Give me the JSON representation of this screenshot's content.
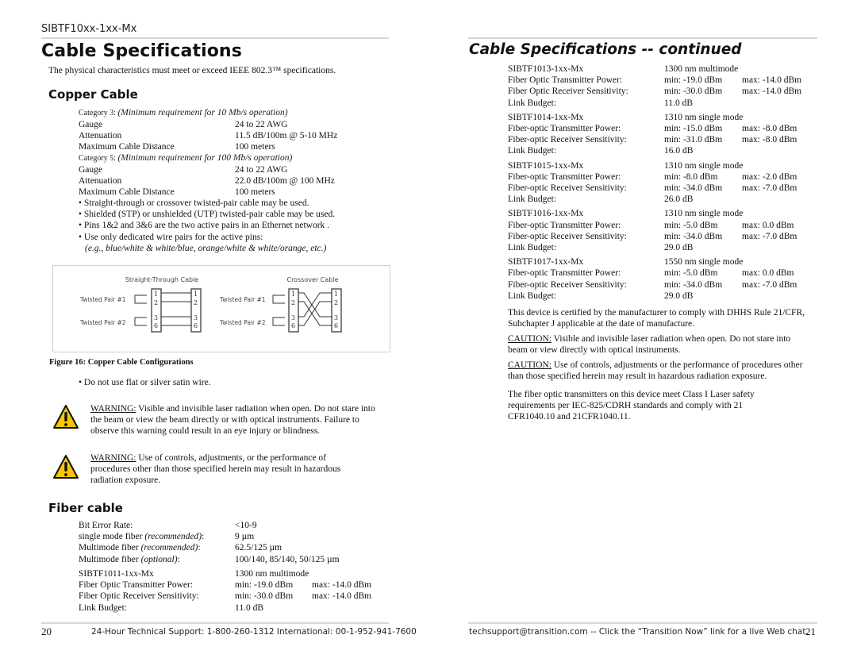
{
  "header": {
    "doc_id": "SIBTF10xx-1xx-Mx"
  },
  "left_page": {
    "title": "Cable Specifications",
    "intro": "The physical characteristics must meet or exceed IEEE 802.3™ specifications.",
    "copper": {
      "heading": "Copper Cable",
      "categories": [
        {
          "label": "Category 3:",
          "note": "(Minimum requirement for 10 Mb/s operation)",
          "rows": [
            {
              "k": "Gauge",
              "v": "24 to 22 AWG"
            },
            {
              "k": "Attenuation",
              "v": "11.5 dB/100m @ 5-10 MHz"
            },
            {
              "k": "Maximum Cable Distance",
              "v": "100 meters"
            }
          ]
        },
        {
          "label": "Category 5:",
          "note": "(Minimum requirement for 100 Mb/s operation)",
          "rows": [
            {
              "k": "Gauge",
              "v": "24 to 22 AWG"
            },
            {
              "k": "Attenuation",
              "v": "22.0 dB/100m @ 100 MHz"
            },
            {
              "k": "Maximum Cable Distance",
              "v": "100 meters"
            }
          ]
        }
      ],
      "bullets": [
        "Straight-through or crossover twisted-pair cable may be used.",
        "Shielded (STP) or unshielded (UTP) twisted-pair cable may be used.",
        "Pins 1&2 and 3&6 are the two active pairs in an Ethernet network .",
        "Use only dedicated wire pairs for the active pins:"
      ],
      "bullet_example": "(e.g., blue/white & white/blue, orange/white & white/orange, etc.)"
    },
    "figure": {
      "straight_title": "Straight-Through Cable",
      "crossover_title": "Crossover Cable",
      "pair1": "Twisted Pair #1",
      "pair2": "Twisted Pair #2",
      "pins": [
        "1",
        "2",
        "3",
        "6"
      ],
      "caption": "Figure 16:  Copper Cable Configurations"
    },
    "after_figure_bullet": "Do not use flat or silver satin wire.",
    "warnings": [
      {
        "label": "WARNING:",
        "text": " Visible and invisible laser radiation when open. Do not stare into the beam or view the beam directly or with optical instruments. Failure to observe this warning could result in an eye injury or blindness."
      },
      {
        "label": "WARNING:",
        "text": " Use of controls, adjustments, or the performance of procedures other than those specified herein may result in hazardous radiation exposure."
      }
    ],
    "fiber": {
      "heading": "Fiber cable",
      "general": [
        {
          "k": "Bit Error Rate:",
          "k_em": "",
          "v": "<10-9"
        },
        {
          "k": "single mode fiber ",
          "k_em": "(recommended)",
          "k_tail": ":",
          "v": "9 µm"
        },
        {
          "k": "Multimode fiber ",
          "k_em": "(recommended)",
          "k_tail": ":",
          "v": "62.5/125 µm"
        },
        {
          "k": "Multimode fiber ",
          "k_em": "(optional)",
          "k_tail": ":",
          "v": "100/140, 85/140, 50/125 µm"
        }
      ],
      "model": {
        "name": "SIBTF1011-1xx-Mx",
        "mode": "1300 nm multimode",
        "rows": [
          {
            "k": "Fiber Optic Transmitter Power:",
            "min": "min: -19.0 dBm",
            "max": "max: -14.0 dBm"
          },
          {
            "k": "Fiber Optic Receiver Sensitivity:",
            "min": "min: -30.0 dBm",
            "max": "max: -14.0 dBm"
          }
        ],
        "link_label": "Link Budget:",
        "link_value": "11.0 dB"
      }
    },
    "footer": {
      "page_number": "20",
      "text": "24-Hour Technical Support: 1-800-260-1312  International: 00-1-952-941-7600"
    }
  },
  "right_page": {
    "title": "Cable Specifications -- continued",
    "models": [
      {
        "name": "SIBTF1013-1xx-Mx",
        "mode": "1300 nm multimode",
        "rows": [
          {
            "k": "Fiber Optic Transmitter Power:",
            "min": "min: -19.0 dBm",
            "max": "max: -14.0 dBm"
          },
          {
            "k": "Fiber Optic Receiver Sensitivity:",
            "min": "min: -30.0 dBm",
            "max": "max: -14.0 dBm"
          }
        ],
        "link_label": "Link Budget:",
        "link_value": "11.0 dB"
      },
      {
        "name": "SIBTF1014-1xx-Mx",
        "mode": "1310 nm single mode",
        "rows": [
          {
            "k": "Fiber-optic Transmitter Power:",
            "min": "min: -15.0 dBm",
            "max": "max: -8.0 dBm"
          },
          {
            "k": "Fiber-optic Receiver Sensitivity:",
            "min": "min: -31.0 dBm",
            "max": "max: -8.0 dBm"
          }
        ],
        "link_label": "Link Budget:",
        "link_value": "16.0 dB"
      },
      {
        "name": "SIBTF1015-1xx-Mx",
        "mode": "1310 nm single mode",
        "rows": [
          {
            "k": "Fiber-optic Transmitter Power:",
            "min": "min: -8.0 dBm",
            "max": "max: -2.0 dBm"
          },
          {
            "k": "Fiber-optic Receiver Sensitivity:",
            "min": "min: -34.0 dBm",
            "max": "max: -7.0 dBm"
          }
        ],
        "link_label": "Link Budget:",
        "link_value": "26.0 dB"
      },
      {
        "name": "SIBTF1016-1xx-Mx",
        "mode": "1310 nm single mode",
        "rows": [
          {
            "k": "Fiber-optic Transmitter Power:",
            "min": "min: -5.0 dBm",
            "max": "max: 0.0 dBm"
          },
          {
            "k": "Fiber-optic Receiver Sensitivity:",
            "min": "min: -34.0 dBm",
            "max": "max: -7.0 dBm"
          }
        ],
        "link_label": "Link Budget:",
        "link_value": "29.0 dB"
      },
      {
        "name": "SIBTF1017-1xx-Mx",
        "mode": "1550 nm single mode",
        "rows": [
          {
            "k": "Fiber-optic Transmitter Power:",
            "min": "min: -5.0 dBm",
            "max": "max: 0.0 dBm"
          },
          {
            "k": "Fiber-optic Receiver Sensitivity:",
            "min": "min: -34.0 dBm",
            "max": "max: -7.0 dBm"
          }
        ],
        "link_label": "Link Budget:",
        "link_value": "29.0 dB"
      }
    ],
    "certification": "This device is certified by the manufacturer to comply with DHHS Rule 21/CFR, Subchapter J applicable at the date of manufacture.",
    "cautions": [
      {
        "label": "CAUTION:",
        "text": "  Visible and invisible laser radiation when open. Do not stare into beam or view directly with optical instruments."
      },
      {
        "label": "CAUTION:",
        "text": "  Use of controls, adjustments or the performance of procedures other than those specified herein may result in hazardous radiation exposure."
      }
    ],
    "laser_class": "The fiber optic transmitters on this device meet Class I Laser safety requirements per IEC-825/CDRH standards and comply with 21 CFR1040.10 and 21CFR1040.11.",
    "footer": {
      "text": "techsupport@transition.com -- Click the “Transition Now” link for a live Web chat.",
      "page_number": "21"
    }
  },
  "colors": {
    "rule": "#d6d6d6",
    "warning_fill": "#f7c600",
    "text": "#111111"
  }
}
